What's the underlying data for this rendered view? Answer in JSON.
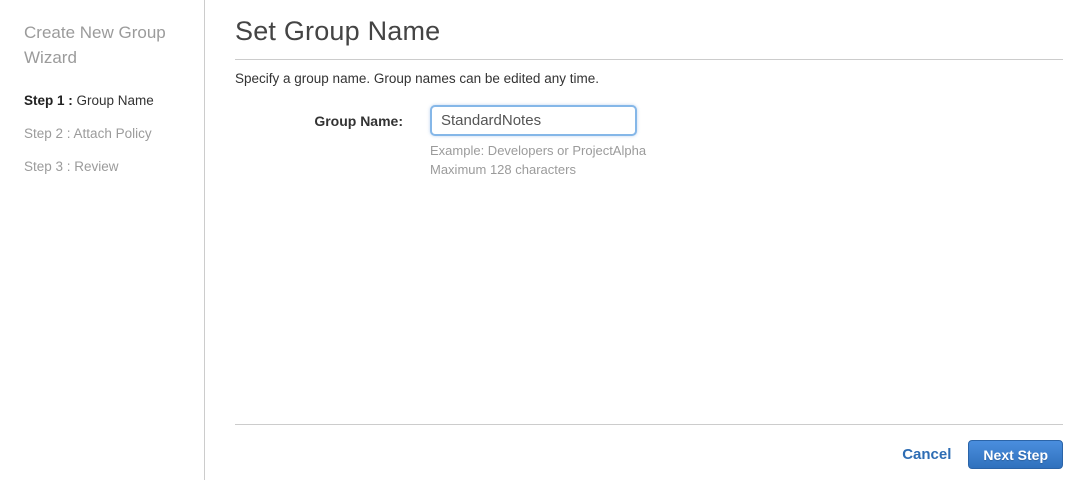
{
  "sidebar": {
    "title": "Create New Group Wizard",
    "steps": [
      {
        "prefix": "Step 1 :",
        "label": " Group Name",
        "active": true
      },
      {
        "prefix": "Step 2 :",
        "label": " Attach Policy",
        "active": false
      },
      {
        "prefix": "Step 3 :",
        "label": " Review",
        "active": false
      }
    ]
  },
  "main": {
    "title": "Set Group Name",
    "description": "Specify a group name. Group names can be edited any time.",
    "form": {
      "label": "Group Name:",
      "value": "StandardNotes",
      "hint_example": "Example: Developers or ProjectAlpha",
      "hint_max": "Maximum 128 characters"
    },
    "footer": {
      "cancel_label": "Cancel",
      "next_label": "Next Step"
    }
  },
  "colors": {
    "accent_blue": "#2e6db4",
    "button_gradient_top": "#4a8ede",
    "button_gradient_bottom": "#3071bd",
    "input_focus_border": "#85b7e8",
    "divider": "#cccccc",
    "muted_text": "#9b9b9b"
  }
}
